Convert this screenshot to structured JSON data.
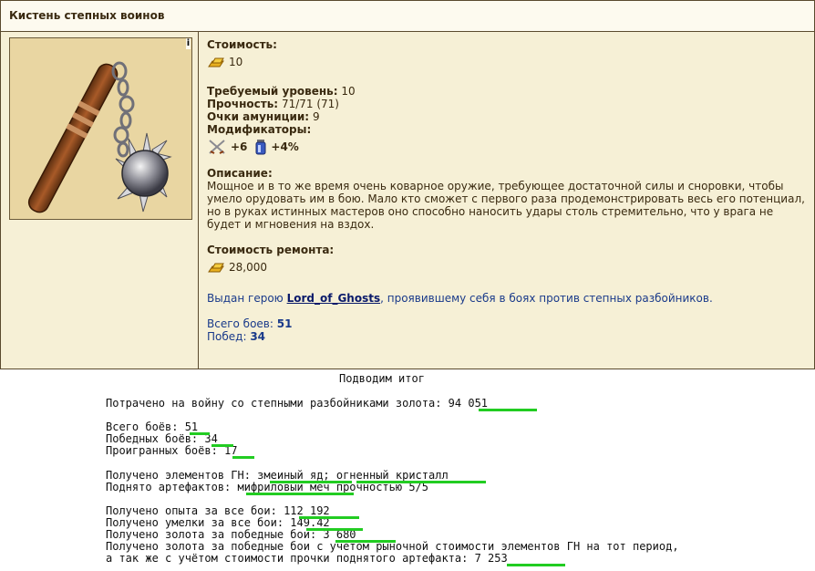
{
  "item": {
    "title": "Кистень степных воинов",
    "cost_label": "Стоимость:",
    "cost_value": "10",
    "level_label": "Требуемый уровень:",
    "level_value": "10",
    "durability_label": "Прочность:",
    "durability_value": "71/71 (71)",
    "ammo_label": "Очки амуниции:",
    "ammo_value": "9",
    "modifiers_label": "Модификаторы:",
    "mod1": "+6",
    "mod2": "+4%",
    "desc_label": "Описание:",
    "desc_text": "Мощное и в то же время очень коварное оружие, требующее достаточной силы и сноровки, чтобы умело орудовать им в бою. Мало кто сможет с первого раза продемонстрировать весь его потенциал, но в руках истинных мастеров оно способно наносить удары столь стремительно, что у врага не будет и мгновения на вздох.",
    "repair_label": "Стоимость ремонта:",
    "repair_value": "28,000",
    "awarded_prefix": "Выдан герою ",
    "hero_name": "Lord_of_Ghosts",
    "awarded_suffix": ", проявившему себя в боях против степных разбойников.",
    "battles_label": "Всего боев:",
    "battles_value": "51",
    "wins_label": "Побед:",
    "wins_value": "34",
    "info_glyph": "i"
  },
  "summary": {
    "title": "Подводим итог",
    "spent": "Потрачено на войну со степными разбойниками золота: 94 051",
    "total": "Всего боёв: 51",
    "won": "Победных боёв: 34",
    "lost": "Проигранных боёв: 17",
    "elements": "Получено элементов ГН: змеиный яд; огненный кристалл",
    "artifacts": "Поднято артефактов: мифриловый меч прочностью 5/5",
    "exp": "Получено опыта за все бои: 112 192",
    "skill": "Получено умелки за все бои: 149.42",
    "gold_wins": "Получено золота за победные бои: 3 680",
    "gold_market1": "Получено золота за победные бои с учетом рыночной стоимости элементов ГН на тот период,",
    "gold_market2": "а так же с учётом стоимости прочки поднятого артефакта: 7 253"
  },
  "colors": {
    "highlight": "#22cc22",
    "border": "#5a4a2e",
    "panel": "#f6f0d6"
  },
  "icons": [
    "gold-icon",
    "crossed-swords-icon",
    "potion-icon",
    "flail-weapon-icon",
    "info-icon"
  ]
}
